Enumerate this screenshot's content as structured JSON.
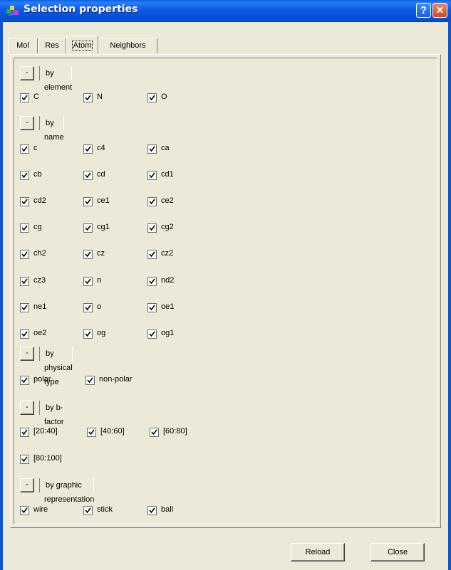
{
  "window": {
    "title": "Selection properties",
    "help_glyph": "?",
    "close_glyph": "✕"
  },
  "tabs": [
    {
      "label": "Mol",
      "active": false
    },
    {
      "label": "Res",
      "active": false
    },
    {
      "label": "Atom",
      "active": true
    },
    {
      "label": "Neighbors",
      "active": false
    }
  ],
  "sections": {
    "by_element": {
      "button": "-",
      "label": "by element",
      "items": [
        "C",
        "N",
        "O"
      ]
    },
    "by_name": {
      "button": "-",
      "label": "by name",
      "items": [
        "c",
        "c4",
        "ca",
        "cb",
        "cd",
        "cd1",
        "cd2",
        "ce1",
        "ce2",
        "cg",
        "cg1",
        "cg2",
        "ch2",
        "cz",
        "cz2",
        "cz3",
        "n",
        "nd2",
        "ne1",
        "o",
        "oe1",
        "oe2",
        "og",
        "og1"
      ]
    },
    "by_physical_type": {
      "button": "-",
      "label": "by physical type",
      "items": [
        "polar",
        "non-polar"
      ]
    },
    "by_bfactor": {
      "button": "-",
      "label": "by b-factor",
      "items": [
        "[20:40]",
        "[40:60]",
        "[60:80]",
        "[80:100]"
      ]
    },
    "by_graphic": {
      "button": "-",
      "label": "by graphic representation",
      "items": [
        "wire",
        "stick",
        "ball"
      ]
    }
  },
  "buttons": {
    "reload": "Reload",
    "close": "Close"
  }
}
